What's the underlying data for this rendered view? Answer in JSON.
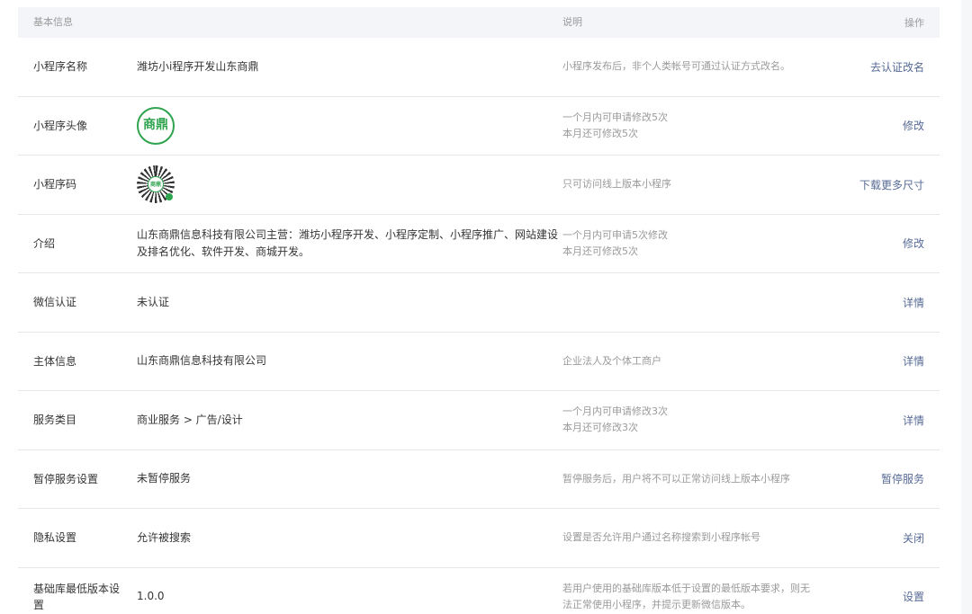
{
  "header": {
    "col_basic": "基本信息",
    "col_desc": "说明",
    "col_op": "操作"
  },
  "rows": [
    {
      "label": "小程序名称",
      "value": "潍坊小i程序开发山东商鼎",
      "desc": [
        "小程序发布后，非个人类帐号可通过认证方式改名。"
      ],
      "op": "去认证改名"
    },
    {
      "label": "小程序头像",
      "avatar_text": "商鼎",
      "desc": [
        "一个月内可申请修改5次",
        "本月还可修改5次"
      ],
      "op": "修改"
    },
    {
      "label": "小程序码",
      "qrcode_logo": "商鼎",
      "desc": [
        "只可访问线上版本小程序"
      ],
      "op": "下载更多尺寸"
    },
    {
      "label": "介绍",
      "value_lines": [
        "山东商鼎信息科技有限公司主营：潍坊小程序开发、小程序定制、小程序推广、网站建设",
        "及排名优化、软件开发、商城开发。"
      ],
      "desc": [
        "一个月内可申请5次修改",
        "本月还可修改5次"
      ],
      "op": "修改"
    },
    {
      "label": "微信认证",
      "value": "未认证",
      "desc": [],
      "op": "详情"
    },
    {
      "label": "主体信息",
      "value": "山东商鼎信息科技有限公司",
      "desc": [
        "企业法人及个体工商户"
      ],
      "op": "详情"
    },
    {
      "label": "服务类目",
      "value": "商业服务 > 广告/设计",
      "desc": [
        "一个月内可申请修改3次",
        "本月还可修改3次"
      ],
      "op": "详情"
    },
    {
      "label": "暂停服务设置",
      "value": "未暂停服务",
      "desc": [
        "暂停服务后，用户将不可以正常访问线上版本小程序"
      ],
      "op": "暂停服务"
    },
    {
      "label": "隐私设置",
      "value": "允许被搜索",
      "desc": [
        "设置是否允许用户通过名称搜索到小程序帐号"
      ],
      "op": "关闭"
    },
    {
      "label_lines": [
        "基础库最低版本设",
        "置"
      ],
      "value": "1.0.0",
      "desc": [
        "若用户使用的基础库版本低于设置的最低版本要求，则无",
        "法正常使用小程序，并提示更新微信版本。"
      ],
      "op": "设置"
    }
  ],
  "colors": {
    "link": "#576b95",
    "header_bg": "#f4f5f9",
    "muted": "#9a9a9a",
    "brand_green": "#2ea44f"
  }
}
